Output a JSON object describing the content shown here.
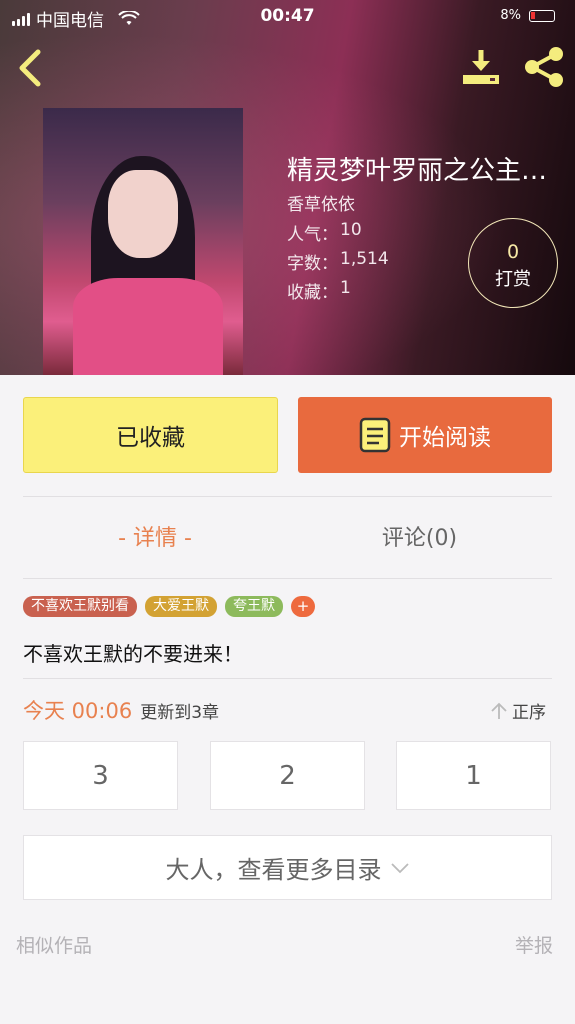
{
  "status_bar": {
    "carrier": "中国电信",
    "time": "00:47",
    "battery_text": "8%"
  },
  "book": {
    "title": "精灵梦叶罗丽之公主…",
    "author": "香草依依",
    "popularity_label": "人气：",
    "popularity": "10",
    "words_label": "字数：",
    "words": "1,514",
    "favorites_label": "收藏：",
    "favorites": "1"
  },
  "tip": {
    "count": "0",
    "label": "打赏"
  },
  "actions": {
    "collected_label": "已收藏",
    "read_label": "开始阅读"
  },
  "tabs": {
    "detail": "- 详情 -",
    "comments": "评论(0)"
  },
  "tags": [
    {
      "label": "不喜欢王默别看",
      "color": "#c9614f"
    },
    {
      "label": "大爱王默",
      "color": "#d3a233"
    },
    {
      "label": "夸王默",
      "color": "#8dba5c"
    }
  ],
  "tag_add": "+",
  "description": "不喜欢王默的不要进来！",
  "update": {
    "time": "今天 00:06",
    "text": "更新到3章",
    "sort_label": "正序"
  },
  "chapters": [
    "3",
    "2",
    "1"
  ],
  "more_catalog": "大人，查看更多目录",
  "footer": {
    "similar": "相似作品",
    "report": "举报"
  },
  "colors": {
    "accent_orange": "#e86a3e",
    "accent_yellow": "#fbf07a"
  }
}
